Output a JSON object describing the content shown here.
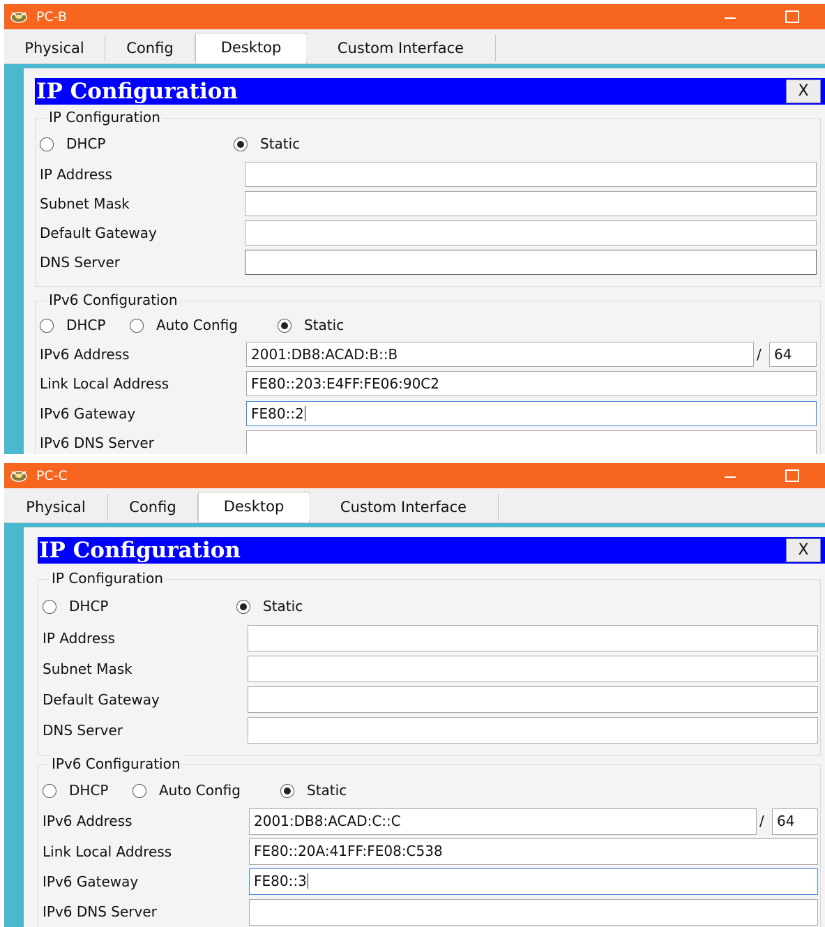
{
  "windows": [
    {
      "title": "PC-B",
      "tabs": [
        "Physical",
        "Config",
        "Desktop",
        "Custom Interface"
      ],
      "active_tab": "Desktop",
      "dialog_title": "IP Configuration",
      "close_label": "X",
      "ipv4": {
        "legend": "IP Configuration",
        "dhcp_label": "DHCP",
        "static_label": "Static",
        "selected": "Static",
        "ip_address_label": "IP Address",
        "ip_address": "",
        "subnet_mask_label": "Subnet Mask",
        "subnet_mask": "",
        "default_gateway_label": "Default Gateway",
        "default_gateway": "",
        "dns_server_label": "DNS Server",
        "dns_server": ""
      },
      "ipv6": {
        "legend": "IPv6 Configuration",
        "dhcp_label": "DHCP",
        "auto_config_label": "Auto Config",
        "static_label": "Static",
        "selected": "Static",
        "address_label": "IPv6 Address",
        "address": "2001:DB8:ACAD:B::B",
        "prefix_separator": "/",
        "prefix": "64",
        "link_local_label": "Link Local Address",
        "link_local": "FE80::203:E4FF:FE06:90C2",
        "gateway_label": "IPv6 Gateway",
        "gateway": "FE80::2",
        "dns_label": "IPv6 DNS Server",
        "dns": ""
      }
    },
    {
      "title": "PC-C",
      "tabs": [
        "Physical",
        "Config",
        "Desktop",
        "Custom Interface"
      ],
      "active_tab": "Desktop",
      "dialog_title": "IP Configuration",
      "close_label": "X",
      "ipv4": {
        "legend": "IP Configuration",
        "dhcp_label": "DHCP",
        "static_label": "Static",
        "selected": "Static",
        "ip_address_label": "IP Address",
        "ip_address": "",
        "subnet_mask_label": "Subnet Mask",
        "subnet_mask": "",
        "default_gateway_label": "Default Gateway",
        "default_gateway": "",
        "dns_server_label": "DNS Server",
        "dns_server": ""
      },
      "ipv6": {
        "legend": "IPv6 Configuration",
        "dhcp_label": "DHCP",
        "auto_config_label": "Auto Config",
        "static_label": "Static",
        "selected": "Static",
        "address_label": "IPv6 Address",
        "address": "2001:DB8:ACAD:C::C",
        "prefix_separator": "/",
        "prefix": "64",
        "link_local_label": "Link Local Address",
        "link_local": "FE80::20A:41FF:FE08:C538",
        "gateway_label": "IPv6 Gateway",
        "gateway": "FE80::3",
        "dns_label": "IPv6 DNS Server",
        "dns": ""
      }
    }
  ],
  "colors": {
    "titlebar": "#f7651e",
    "desktop_bg": "#4cb8cf",
    "dialog_header": "#0000ff",
    "focus_border": "#3e8ad9"
  },
  "icons": {
    "app": "packet-tracer-pc-icon",
    "minimize": "minimize-icon",
    "maximize": "maximize-icon",
    "close": "close-icon"
  }
}
